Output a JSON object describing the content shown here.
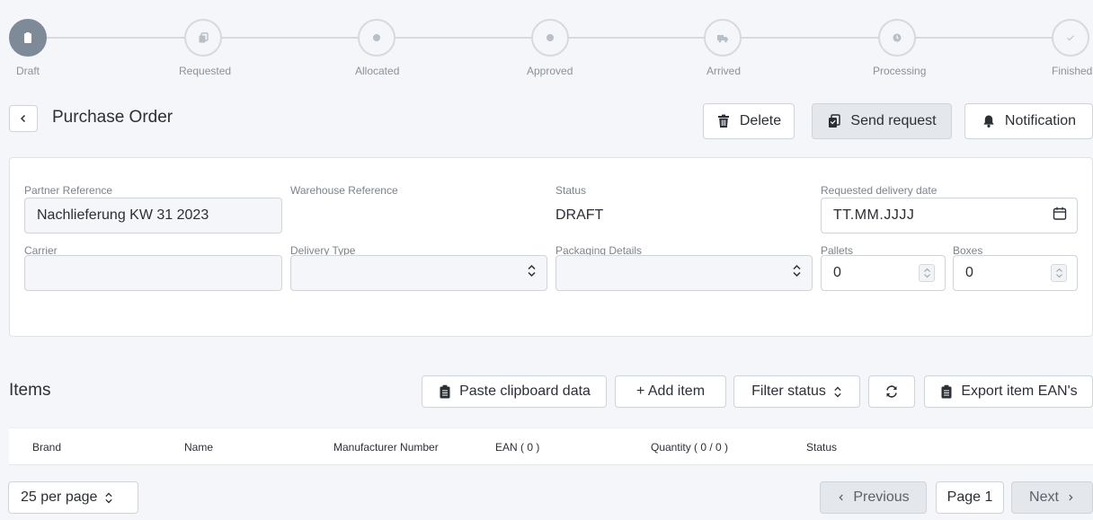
{
  "stepper": {
    "steps": [
      {
        "label": "Draft",
        "icon": "clipboard-icon",
        "active": true
      },
      {
        "label": "Requested",
        "icon": "copy-icon",
        "active": false
      },
      {
        "label": "Allocated",
        "icon": "dot-icon",
        "active": false
      },
      {
        "label": "Approved",
        "icon": "dot-icon",
        "active": false
      },
      {
        "label": "Arrived",
        "icon": "truck-icon",
        "active": false
      },
      {
        "label": "Processing",
        "icon": "clock-icon",
        "active": false
      },
      {
        "label": "Finished",
        "icon": "check-icon",
        "active": false
      }
    ]
  },
  "header": {
    "title": "Purchase Order",
    "delete_label": "Delete",
    "send_request_label": "Send request",
    "notification_label": "Notification"
  },
  "form": {
    "partner_reference": {
      "label": "Partner Reference",
      "value": "Nachlieferung KW 31 2023"
    },
    "warehouse_reference": {
      "label": "Warehouse Reference"
    },
    "status": {
      "label": "Status",
      "value": "DRAFT"
    },
    "requested_delivery_date": {
      "label": "Requested delivery date",
      "placeholder": "TT.MM.JJJJ"
    },
    "carrier": {
      "label": "Carrier",
      "value": ""
    },
    "delivery_type": {
      "label": "Delivery Type",
      "value": ""
    },
    "packaging_details": {
      "label": "Packaging Details",
      "value": ""
    },
    "pallets": {
      "label": "Pallets",
      "value": "0"
    },
    "boxes": {
      "label": "Boxes",
      "value": "0"
    }
  },
  "items": {
    "title": "Items",
    "paste_label": "Paste clipboard data",
    "add_label": "+ Add item",
    "filter_label": "Filter status",
    "export_label": "Export item EAN's",
    "columns": [
      "Brand",
      "Name",
      "Manufacturer Number",
      "EAN ( 0 )",
      "Quantity ( 0 / 0 )",
      "Status"
    ]
  },
  "pagination": {
    "per_page": "25 per page",
    "previous": "Previous",
    "page": "Page 1",
    "next": "Next"
  },
  "colors": {
    "active_step": "#7f8a99",
    "background": "#f4f6f9"
  }
}
